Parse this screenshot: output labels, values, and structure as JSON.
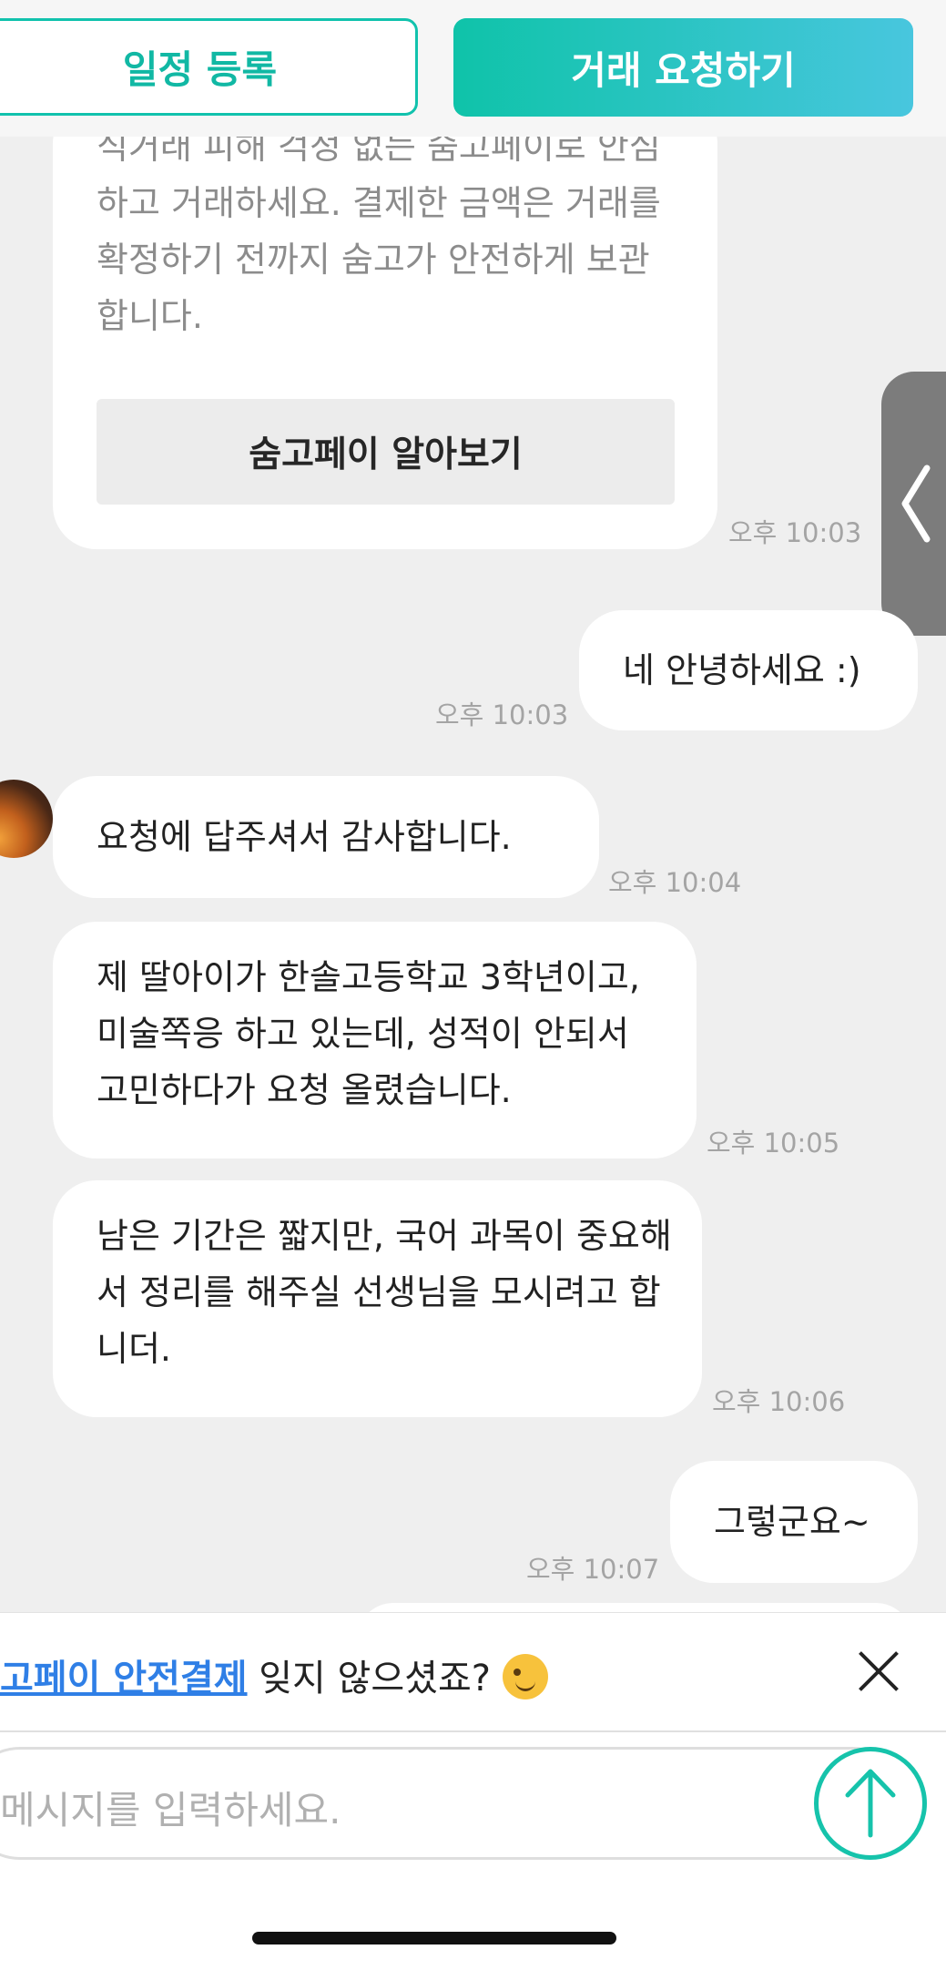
{
  "top_actions": {
    "schedule_label": "일정 등록",
    "request_deal_label": "거래 요청하기"
  },
  "card": {
    "text": "식거래 피해 걱정 없는 숨고페이로 안심하고 거래하세요. 결제한 금액은 거래를 확정하기 전까지 숨고가 안전하게 보관합니다.",
    "button_label": "숨고페이 알아보기",
    "time": "오후 10:03"
  },
  "messages": [
    {
      "side": "right",
      "text": "네 안녕하세요 :)",
      "time": "오후 10:03"
    },
    {
      "side": "left",
      "text": "요청에 답주셔서 감사합니다.",
      "time": "오후 10:04"
    },
    {
      "side": "left",
      "text": "제 딸아이가 한솔고등학교 3학년이고, 미술쪽응 하고 있는데, 성적이 안되서 고민하다가 요청 올렸습니다.",
      "time": "오후 10:05"
    },
    {
      "side": "left",
      "text": "남은 기간은 짧지만, 국어 과목이 중요해서 정리를 해주실 선생님을 모시려고 합니더.",
      "time": "오후 10:06"
    },
    {
      "side": "right",
      "text": "그렇군요~",
      "time": "오후 10:07"
    }
  ],
  "notice": {
    "link_text": "고페이 안전결제",
    "rest_text": " 잊지 않으셨죠? ",
    "emoji": "winking-face"
  },
  "composer": {
    "placeholder": "메시지를 입력하세요."
  },
  "colors": {
    "accent": "#11c2ad",
    "link": "#2f7fe6",
    "bubble": "#ffffff",
    "background": "#efefef"
  }
}
